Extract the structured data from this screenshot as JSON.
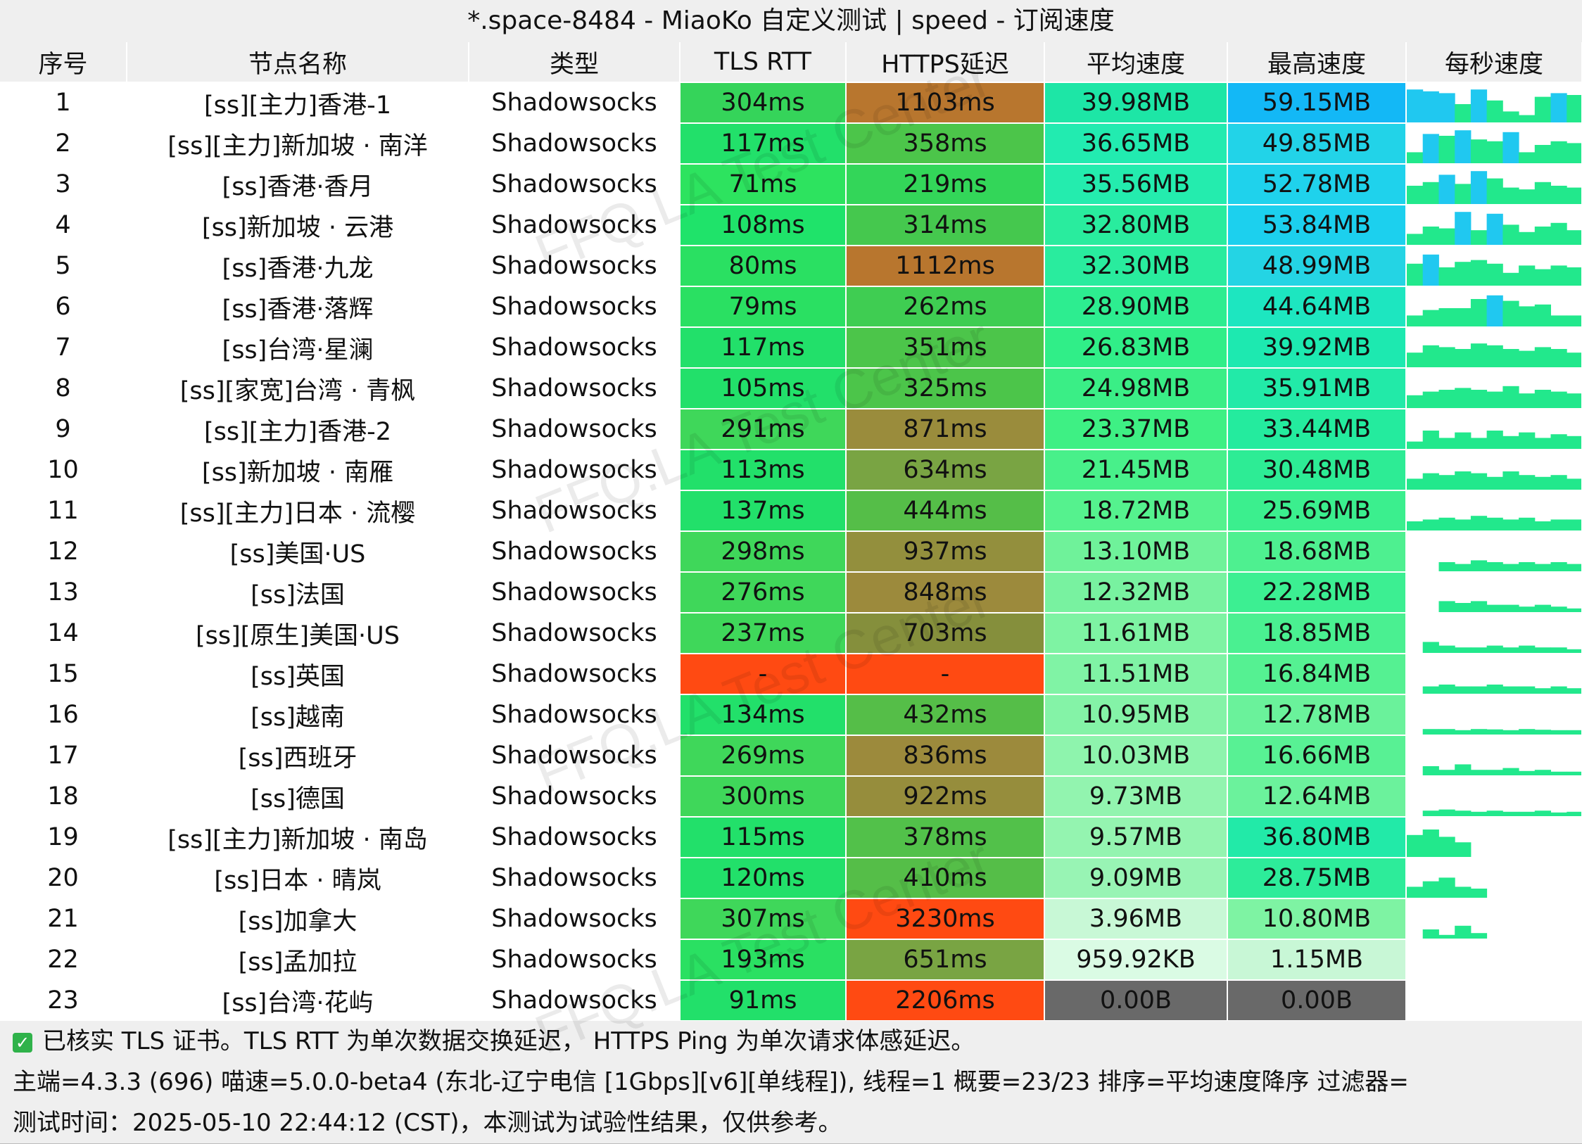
{
  "window": {
    "title": "*.space-8484 - MiaoKo 自定义测试 | speed - 订阅速度"
  },
  "columns": [
    "序号",
    "节点名称",
    "类型",
    "TLS RTT",
    "HTTPS延迟",
    "平均速度",
    "最高速度",
    "每秒速度"
  ],
  "rows": [
    {
      "idx": "1",
      "name": "[ss][主力]香港-1",
      "type": "Shadowsocks",
      "tls": "304ms",
      "https": "1103ms",
      "avg": "39.98MB",
      "max": "59.15MB",
      "graph": [
        0.9,
        0.85,
        0.8,
        0.5,
        0.9,
        0.6,
        0.3,
        0.2,
        0.7,
        0.8,
        0.75
      ]
    },
    {
      "idx": "2",
      "name": "[ss][主力]新加坡 · 南洋",
      "type": "Shadowsocks",
      "tls": "117ms",
      "https": "358ms",
      "avg": "36.65MB",
      "max": "49.85MB",
      "graph": [
        0.3,
        0.8,
        0.75,
        0.9,
        0.65,
        0.6,
        0.85,
        0.3,
        0.5,
        0.6,
        0.55
      ]
    },
    {
      "idx": "3",
      "name": "[ss]香港·香月",
      "type": "Shadowsocks",
      "tls": "71ms",
      "https": "219ms",
      "avg": "35.56MB",
      "max": "52.78MB",
      "graph": [
        0.5,
        0.6,
        0.8,
        0.55,
        0.9,
        0.7,
        0.45,
        0.4,
        0.6,
        0.5,
        0.45
      ]
    },
    {
      "idx": "4",
      "name": "[ss]新加坡 · 云港",
      "type": "Shadowsocks",
      "tls": "108ms",
      "https": "314ms",
      "avg": "32.80MB",
      "max": "53.84MB",
      "graph": [
        0.3,
        0.5,
        0.45,
        0.9,
        0.4,
        0.85,
        0.55,
        0.35,
        0.5,
        0.6,
        0.4
      ]
    },
    {
      "idx": "5",
      "name": "[ss]香港·九龙",
      "type": "Shadowsocks",
      "tls": "80ms",
      "https": "1112ms",
      "avg": "32.30MB",
      "max": "48.99MB",
      "graph": [
        0.6,
        0.85,
        0.5,
        0.65,
        0.7,
        0.6,
        0.35,
        0.55,
        0.45,
        0.55,
        0.5
      ]
    },
    {
      "idx": "6",
      "name": "[ss]香港·落辉",
      "type": "Shadowsocks",
      "tls": "79ms",
      "https": "262ms",
      "avg": "28.90MB",
      "max": "44.64MB",
      "graph": [
        0.3,
        0.45,
        0.5,
        0.5,
        0.75,
        0.85,
        0.7,
        0.55,
        0.6,
        0.3,
        0.3
      ]
    },
    {
      "idx": "7",
      "name": "[ss]台湾·星澜",
      "type": "Shadowsocks",
      "tls": "117ms",
      "https": "351ms",
      "avg": "26.83MB",
      "max": "39.92MB",
      "graph": [
        0.4,
        0.6,
        0.55,
        0.5,
        0.65,
        0.6,
        0.5,
        0.45,
        0.55,
        0.5,
        0.4
      ]
    },
    {
      "idx": "8",
      "name": "[ss][家宽]台湾 · 青枫",
      "type": "Shadowsocks",
      "tls": "105ms",
      "https": "325ms",
      "avg": "24.98MB",
      "max": "35.91MB",
      "graph": [
        0.35,
        0.45,
        0.5,
        0.55,
        0.5,
        0.45,
        0.6,
        0.4,
        0.5,
        0.45,
        0.4
      ]
    },
    {
      "idx": "9",
      "name": "[ss][主力]香港-2",
      "type": "Shadowsocks",
      "tls": "291ms",
      "https": "871ms",
      "avg": "23.37MB",
      "max": "33.44MB",
      "graph": [
        0.2,
        0.5,
        0.3,
        0.45,
        0.3,
        0.5,
        0.35,
        0.45,
        0.3,
        0.4,
        0.35
      ]
    },
    {
      "idx": "10",
      "name": "[ss]新加坡 · 南雁",
      "type": "Shadowsocks",
      "tls": "113ms",
      "https": "634ms",
      "avg": "21.45MB",
      "max": "30.48MB",
      "graph": [
        0.3,
        0.45,
        0.4,
        0.5,
        0.45,
        0.35,
        0.5,
        0.4,
        0.35,
        0.4,
        0.3
      ]
    },
    {
      "idx": "11",
      "name": "[ss][主力]日本 · 流樱",
      "type": "Shadowsocks",
      "tls": "137ms",
      "https": "444ms",
      "avg": "18.72MB",
      "max": "25.69MB",
      "graph": [
        0.25,
        0.3,
        0.35,
        0.3,
        0.4,
        0.35,
        0.3,
        0.35,
        0.25,
        0.3,
        0.3
      ]
    },
    {
      "idx": "12",
      "name": "[ss]美国·US",
      "type": "Shadowsocks",
      "tls": "298ms",
      "https": "937ms",
      "avg": "13.10MB",
      "max": "18.68MB",
      "graph": [
        0.0,
        0.0,
        0.25,
        0.2,
        0.3,
        0.25,
        0.2,
        0.25,
        0.2,
        0.25,
        0.2
      ]
    },
    {
      "idx": "13",
      "name": "[ss]法国",
      "type": "Shadowsocks",
      "tls": "276ms",
      "https": "848ms",
      "avg": "12.32MB",
      "max": "22.28MB",
      "graph": [
        0.0,
        0.0,
        0.3,
        0.25,
        0.3,
        0.2,
        0.2,
        0.15,
        0.2,
        0.15,
        0.1
      ]
    },
    {
      "idx": "14",
      "name": "[ss][原生]美国·US",
      "type": "Shadowsocks",
      "tls": "237ms",
      "https": "703ms",
      "avg": "11.61MB",
      "max": "18.85MB",
      "graph": [
        0.0,
        0.3,
        0.2,
        0.15,
        0.15,
        0.2,
        0.15,
        0.2,
        0.15,
        0.15,
        0.1
      ]
    },
    {
      "idx": "15",
      "name": "[ss]英国",
      "type": "Shadowsocks",
      "tls": "-",
      "https": "-",
      "avg": "11.51MB",
      "max": "16.84MB",
      "graph": [
        0.0,
        0.2,
        0.25,
        0.2,
        0.2,
        0.25,
        0.2,
        0.2,
        0.15,
        0.2,
        0.15
      ]
    },
    {
      "idx": "16",
      "name": "[ss]越南",
      "type": "Shadowsocks",
      "tls": "134ms",
      "https": "432ms",
      "avg": "10.95MB",
      "max": "12.78MB",
      "graph": [
        0.0,
        0.15,
        0.15,
        0.12,
        0.15,
        0.14,
        0.12,
        0.15,
        0.13,
        0.12,
        0.12
      ]
    },
    {
      "idx": "17",
      "name": "[ss]西班牙",
      "type": "Shadowsocks",
      "tls": "269ms",
      "https": "836ms",
      "avg": "10.03MB",
      "max": "16.66MB",
      "graph": [
        0.0,
        0.25,
        0.15,
        0.3,
        0.15,
        0.15,
        0.2,
        0.12,
        0.15,
        0.1,
        0.1
      ]
    },
    {
      "idx": "18",
      "name": "[ss]德国",
      "type": "Shadowsocks",
      "tls": "300ms",
      "https": "922ms",
      "avg": "9.73MB",
      "max": "12.64MB",
      "graph": [
        0.0,
        0.15,
        0.18,
        0.15,
        0.12,
        0.15,
        0.12,
        0.12,
        0.15,
        0.1,
        0.12
      ]
    },
    {
      "idx": "19",
      "name": "[ss][主力]新加坡 · 南岛",
      "type": "Shadowsocks",
      "tls": "115ms",
      "https": "378ms",
      "avg": "9.57MB",
      "max": "36.80MB",
      "graph": [
        0.6,
        0.75,
        0.55,
        0.4,
        0.0,
        0.0,
        0.0,
        0.0,
        0.0,
        0.0,
        0.0
      ]
    },
    {
      "idx": "20",
      "name": "[ss]日本 · 晴岚",
      "type": "Shadowsocks",
      "tls": "120ms",
      "https": "410ms",
      "avg": "9.09MB",
      "max": "28.75MB",
      "graph": [
        0.3,
        0.45,
        0.55,
        0.3,
        0.25,
        0.0,
        0.0,
        0.0,
        0.0,
        0.0,
        0.0
      ]
    },
    {
      "idx": "21",
      "name": "[ss]加拿大",
      "type": "Shadowsocks",
      "tls": "307ms",
      "https": "3230ms",
      "avg": "3.96MB",
      "max": "10.80MB",
      "graph": [
        0.0,
        0.25,
        0.1,
        0.35,
        0.15,
        0.0,
        0.0,
        0.0,
        0.0,
        0.0,
        0.0
      ]
    },
    {
      "idx": "22",
      "name": "[ss]孟加拉",
      "type": "Shadowsocks",
      "tls": "193ms",
      "https": "651ms",
      "avg": "959.92KB",
      "max": "1.15MB",
      "graph": [
        0.0,
        0.0,
        0.0,
        0.0,
        0.0,
        0.0,
        0.0,
        0.0,
        0.0,
        0.0,
        0.0
      ]
    },
    {
      "idx": "23",
      "name": "[ss]台湾·花屿",
      "type": "Shadowsocks",
      "tls": "91ms",
      "https": "2206ms",
      "avg": "0.00B",
      "max": "0.00B",
      "graph": [
        0.0,
        0.0,
        0.0,
        0.0,
        0.0,
        0.0,
        0.0,
        0.0,
        0.0,
        0.0,
        0.0
      ]
    }
  ],
  "colors": {
    "tls": [
      "#35d45a",
      "#22e06a",
      "#2de35f",
      "#1fe36a",
      "#2ae062",
      "#2ae062",
      "#22e06a",
      "#22e06a",
      "#3fd75a",
      "#22e06a",
      "#22e06a",
      "#3fd75a",
      "#3fd75a",
      "#3fd75a",
      "#ff4a12",
      "#22e06a",
      "#3fd75a",
      "#3fd75a",
      "#22e06a",
      "#22e06a",
      "#3fd75a",
      "#2ae062",
      "#22e06a"
    ],
    "https": [
      "#b8762e",
      "#4cc54a",
      "#33d659",
      "#45c84e",
      "#b8762e",
      "#3fcd52",
      "#4cc54a",
      "#4cc54a",
      "#9a8c3c",
      "#79a443",
      "#55be48",
      "#938f3d",
      "#9c8a3c",
      "#858f3c",
      "#ff4a12",
      "#55be48",
      "#9c8a3c",
      "#968d3c",
      "#52c14a",
      "#55be48",
      "#ff4a12",
      "#79a443",
      "#ff4a12"
    ],
    "avg": [
      "#1de6a6",
      "#22ebb0",
      "#24ecae",
      "#29ec9e",
      "#29ec9e",
      "#2ded90",
      "#30ee88",
      "#3aee86",
      "#3ef084",
      "#48f08a",
      "#55f28e",
      "#6ff29a",
      "#78f2a0",
      "#7ef3a3",
      "#80f3a5",
      "#84f3a7",
      "#8ef4ad",
      "#92f4af",
      "#94f4b0",
      "#98f4b4",
      "#c8f8d6",
      "#dafbe4",
      "#696969"
    ],
    "max": [
      "#13b8f6",
      "#22d3e8",
      "#1fd2ec",
      "#1cd0ee",
      "#24d4e4",
      "#1de6c0",
      "#1de9b0",
      "#22eaa8",
      "#24eb9e",
      "#2dec95",
      "#3bef8e",
      "#4ef090",
      "#3cef92",
      "#4af091",
      "#55f192",
      "#6af29b",
      "#58f194",
      "#6bf29c",
      "#22eaa8",
      "#2dec9a",
      "#7ef3a3",
      "#c8f7d6",
      "#696969"
    ],
    "graph_bar": "#22e88c",
    "graph_accent": "#20c8f0"
  },
  "footer": {
    "line1": "已核实 TLS 证书。TLS RTT 为单次数据交换延迟， HTTPS Ping 为单次请求体感延迟。",
    "line2": "主端=4.3.3 (696) 喵速=5.0.0-beta4 (东北-辽宁电信 [1Gbps][v6][单线程]), 线程=1 概要=23/23 排序=平均速度降序 过滤器=",
    "line3": "测试时间：2025-05-10 22:44:12 (CST)，本测试为试验性结果，仅供参考。"
  },
  "watermark": "FFQ.LA Test Center"
}
